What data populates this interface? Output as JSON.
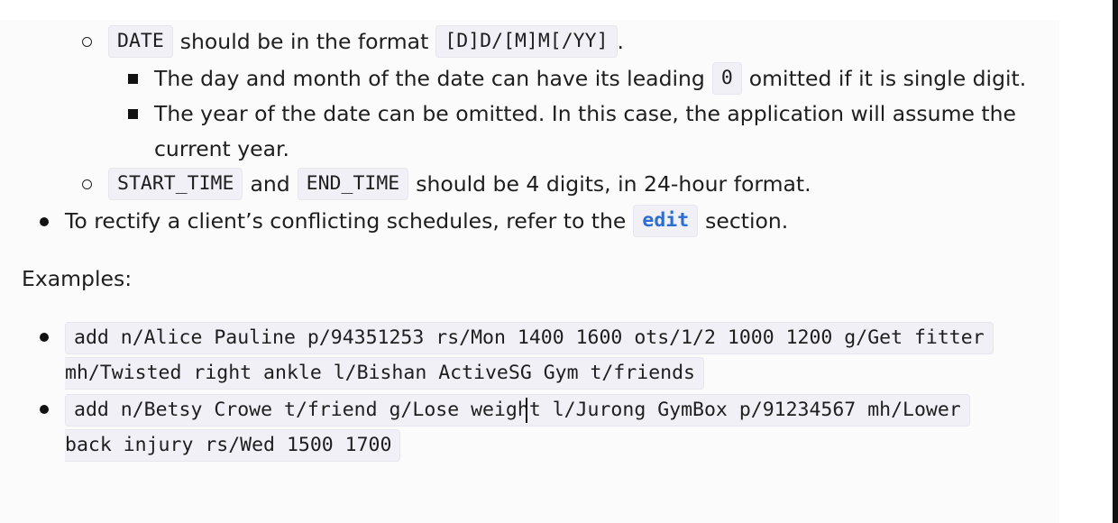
{
  "format_rules": {
    "date_line": {
      "code_date": "DATE",
      "text_mid": "should be in the format",
      "code_fmt": "[D]D/[M]M[/YY]",
      "text_end": "."
    },
    "day_month_line": {
      "text_start": "The day and month of the date can have its leading",
      "code_zero": "0",
      "text_end": "omitted if it is single digit."
    },
    "year_line_1": "The year of the date can be omitted. In this case, the application will assume the",
    "year_line_2": "current year.",
    "time_line": {
      "code_start": "START_TIME",
      "text_and": "and",
      "code_end": "END_TIME",
      "text_end": "should be 4 digits, in 24-hour format."
    },
    "rectify_line": {
      "text_start": "To rectify a client’s conflicting schedules, refer to the",
      "link": "edit",
      "text_end": "section."
    }
  },
  "examples_heading": "Examples:",
  "examples": [
    {
      "line1": "add n/Alice Pauline p/94351253 rs/Mon 1400 1600 ots/1/2 1000 1200 g/Get fitter",
      "line2": "mh/Twisted right ankle l/Bishan ActiveSG Gym t/friends"
    },
    {
      "line1": "add n/Betsy Crowe t/friend g/Lose weight l/Jurong GymBox p/91234567 mh/Lower",
      "line2": "back injury rs/Wed 1500 1700"
    }
  ]
}
